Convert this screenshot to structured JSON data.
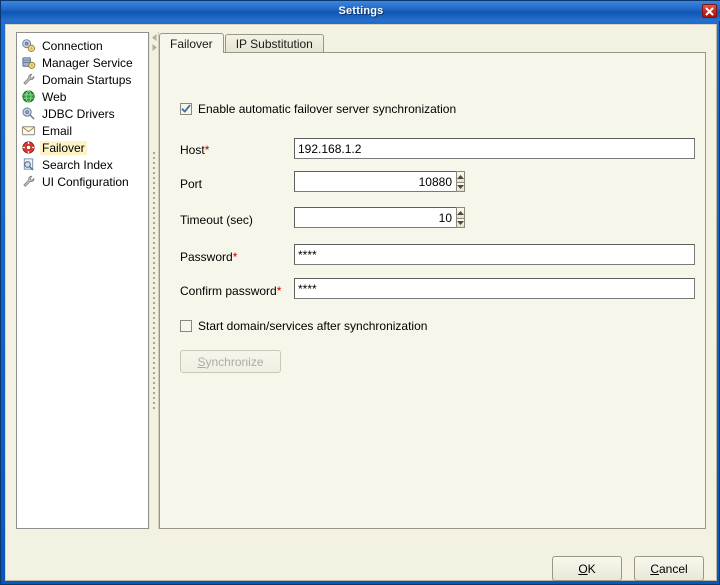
{
  "window": {
    "title": "Settings",
    "close_icon": "close-x-icon"
  },
  "sidebar": {
    "items": [
      {
        "label": "Connection",
        "icon": "gears-icon",
        "selected": false
      },
      {
        "label": "Manager Service",
        "icon": "database-gear-icon",
        "selected": false
      },
      {
        "label": "Domain Startups",
        "icon": "wrench-icon",
        "selected": false
      },
      {
        "label": "Web",
        "icon": "globe-icon",
        "selected": false
      },
      {
        "label": "JDBC Drivers",
        "icon": "gear-plug-icon",
        "selected": false
      },
      {
        "label": "Email",
        "icon": "envelope-icon",
        "selected": false
      },
      {
        "label": "Failover",
        "icon": "lifebuoy-icon",
        "selected": true
      },
      {
        "label": "Search Index",
        "icon": "magnifier-doc-icon",
        "selected": false
      },
      {
        "label": "UI Configuration",
        "icon": "wrench-icon",
        "selected": false
      }
    ],
    "selection_highlight_color": "#fdf3c4"
  },
  "divider": {
    "collapse_left_icon": "triangle-left-icon",
    "collapse_right_icon": "triangle-right-icon"
  },
  "tabs": [
    {
      "label": "Failover",
      "active": true
    },
    {
      "label": "IP Substitution",
      "active": false
    }
  ],
  "form": {
    "enable_checkbox": {
      "label": "Enable automatic failover server synchronization",
      "checked": true
    },
    "host": {
      "label": "Host",
      "required_marker": "*",
      "value": "192.168.1.2"
    },
    "port": {
      "label": "Port",
      "value": "10880"
    },
    "timeout": {
      "label": "Timeout (sec)",
      "value": "10"
    },
    "password": {
      "label": "Password",
      "required_marker": "*",
      "value": "****"
    },
    "confirm_password": {
      "label": "Confirm password",
      "required_marker": "*",
      "value": "****"
    },
    "start_checkbox": {
      "label": "Start domain/services after synchronization",
      "checked": false
    },
    "synchronize_button": {
      "mnemonic": "S",
      "rest": "ynchronize",
      "disabled": true
    }
  },
  "footer": {
    "ok": {
      "pre": "",
      "mnemonic": "O",
      "post": "K"
    },
    "cancel": {
      "pre": "",
      "mnemonic": "C",
      "post": "ancel"
    }
  },
  "colors": {
    "titlebar_blue": "#1c64c4",
    "dialog_bg": "#f2f1e2",
    "panel_bg": "#f7f6ea",
    "close_red": "#c62a22",
    "required_red": "#c00000"
  }
}
